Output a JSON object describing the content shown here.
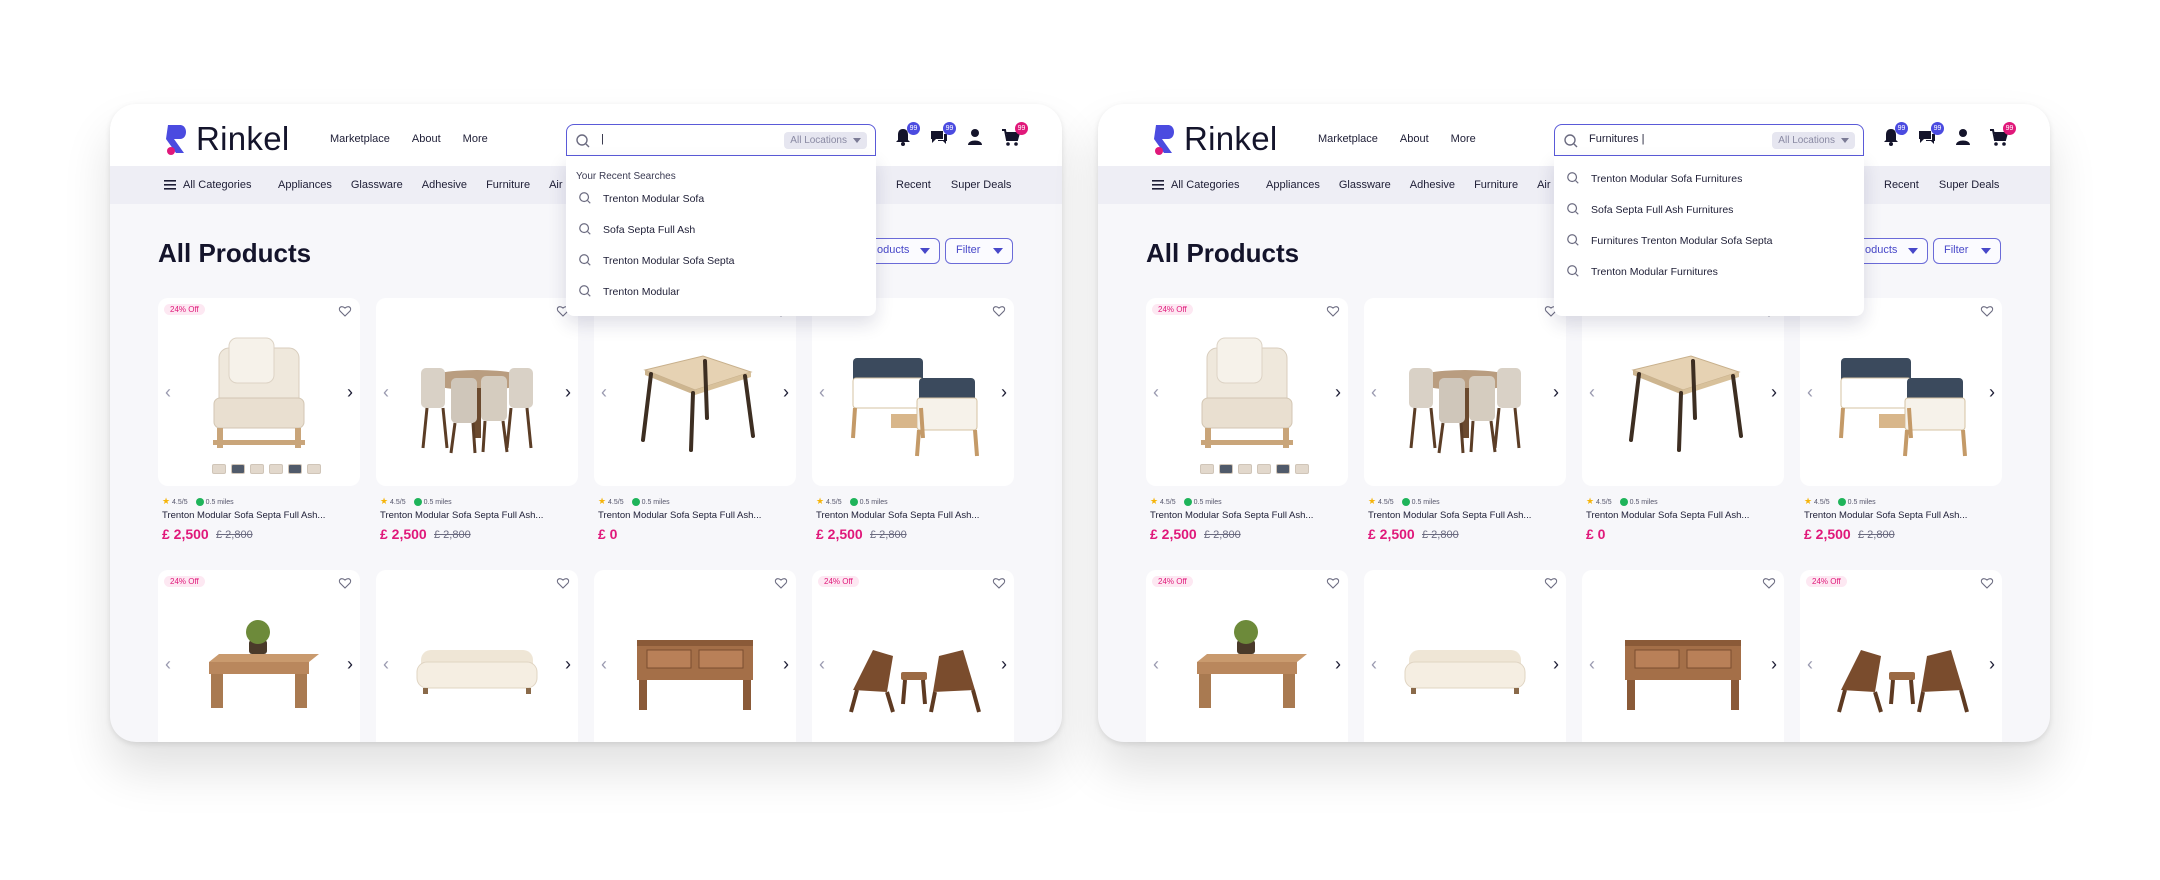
{
  "brand": {
    "name": "Rinkel",
    "accent": "#4b4be0",
    "pink": "#e0187a"
  },
  "nav": [
    "Marketplace",
    "About",
    "More"
  ],
  "location_label": "All Locations",
  "icons": [
    "bell-icon",
    "chat-icon",
    "user-icon",
    "cart-icon"
  ],
  "badges": [
    "99",
    "99",
    "",
    "99"
  ],
  "categories": {
    "all_label": "All Categories",
    "items": [
      "Appliances",
      "Glassware",
      "Adhesive",
      "Furniture",
      "Air"
    ],
    "right": [
      "Recent",
      "Super Deals"
    ]
  },
  "page_title": "All Products",
  "sort_label": "oducts",
  "filter_label": "Filter",
  "products": [
    {
      "off": "24% Off",
      "rating": "4.5/5",
      "distance": "0.5 miles",
      "name": "Trenton Modular Sofa Septa Full Ash...",
      "price": "£ 2,500",
      "old": "£ 2,800",
      "kind": "chair"
    },
    {
      "off": "",
      "rating": "4.5/5",
      "distance": "0.5 miles",
      "name": "Trenton Modular Sofa Septa Full Ash...",
      "price": "£ 2,500",
      "old": "£ 2,800",
      "kind": "dining"
    },
    {
      "off": "",
      "rating": "4.5/5",
      "distance": "0.5 miles",
      "name": "Trenton Modular Sofa Septa Full Ash...",
      "price": "£ 0",
      "old": "",
      "kind": "table"
    },
    {
      "off": "24% Off",
      "rating": "4.5/5",
      "distance": "0.5 miles",
      "name": "Trenton Modular Sofa Septa Full Ash...",
      "price": "£ 2,500",
      "old": "£ 2,800",
      "kind": "outdoor"
    },
    {
      "off": "24% Off",
      "kind": "coffeetable"
    },
    {
      "off": "",
      "kind": "sofa"
    },
    {
      "off": "",
      "kind": "sideboard"
    },
    {
      "off": "24% Off",
      "kind": "loungers"
    }
  ],
  "left_panel": {
    "search_value": "|",
    "dropdown_heading": "Your Recent Searches",
    "dropdown_items": [
      "Trenton Modular Sofa",
      "Sofa Septa Full Ash",
      "Trenton Modular Sofa Septa",
      "Trenton Modular"
    ]
  },
  "right_panel": {
    "search_value": "Furnitures |",
    "dropdown_heading": "",
    "dropdown_items": [
      "Trenton Modular Sofa Furnitures",
      "Sofa Septa Full Ash Furnitures",
      "Furnitures Trenton Modular Sofa Septa",
      "Trenton Modular Furnitures"
    ]
  }
}
